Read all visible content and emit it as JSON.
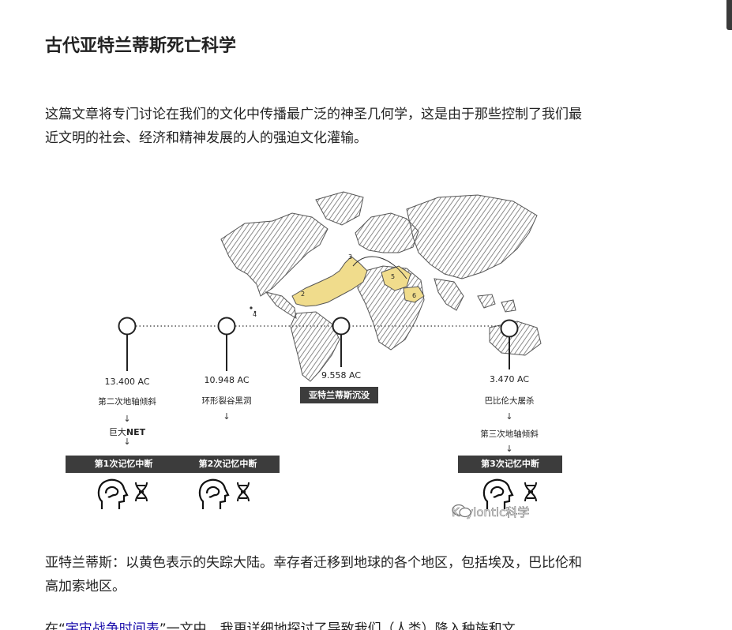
{
  "article": {
    "title": "古代亚特兰蒂斯死亡科学",
    "intro": "这篇文章将专门讨论在我们的文化中传播最广泛的神圣几何学，这是由于那些控制了我们最近文明的社会、经济和精神发展的人的强迫文化灌输。",
    "caption_paragraph": "亚特兰蒂斯：以黄色表示的失踪大陆。幸存者迁移到地球的各个地区，包括埃及，巴比伦和高加索地区。",
    "next_paragraph_prefix": "在“",
    "next_paragraph_link": "宇宙战争时间表",
    "next_paragraph_suffix": "”一文中，我更详细地探讨了导致我们（人类）降入种族和文"
  },
  "figure": {
    "map_labels": [
      "2",
      "3",
      "4",
      "5",
      "6"
    ],
    "timeline": [
      {
        "date": "13.400 AC",
        "event": "第二次地轴倾斜"
      },
      {
        "date": "10.948 AC",
        "event": "环形裂谷黑洞"
      },
      {
        "date": "9.558 AC",
        "event": "亚特兰蒂斯沉没"
      },
      {
        "date": "3.470 AC",
        "event": "巴比伦大屠杀"
      }
    ],
    "arrow": "↓",
    "giant": "巨大",
    "net": "NET",
    "third_tilt": "第三次地轴倾斜",
    "memory_breaks": [
      "第1次记忆中断",
      "第2次记忆中断",
      "第3次记忆中断"
    ],
    "watermark": "Keylontic科学",
    "colors": {
      "atlantis": "#f0dc8c",
      "bar": "#3c3c3c",
      "map_hatch": "#6e6e6e"
    },
    "icons": [
      "head-brain-icon",
      "dna-icon",
      "wechat-icon"
    ]
  }
}
